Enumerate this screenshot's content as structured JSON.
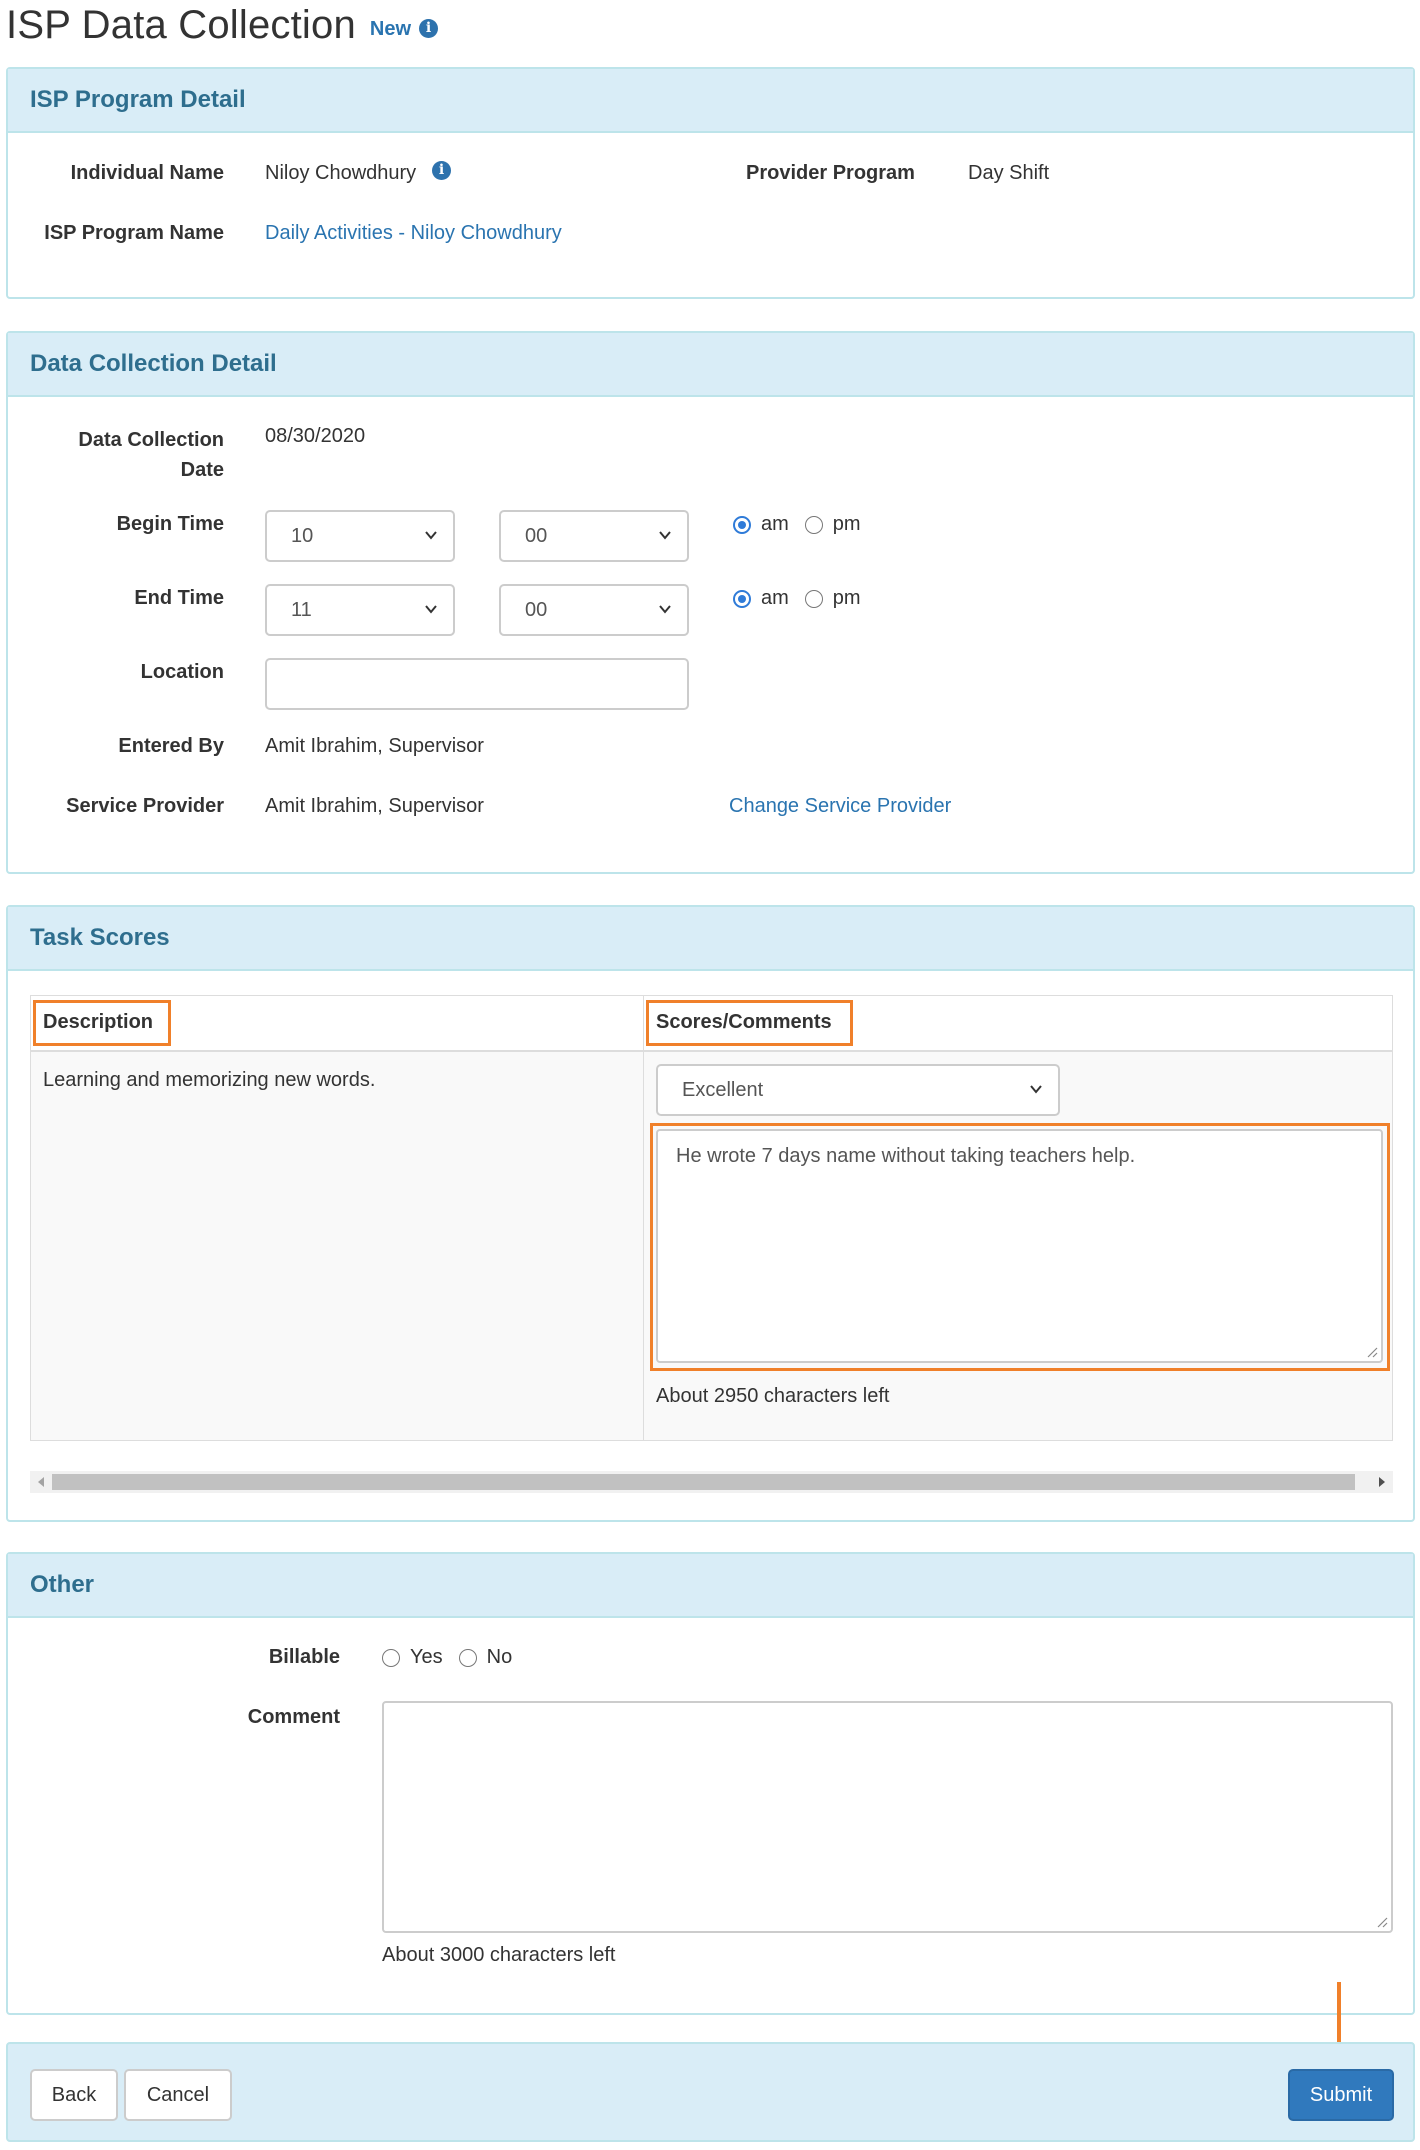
{
  "header": {
    "title": "ISP Data Collection",
    "badge": "New",
    "info_icon": "info-circle-icon"
  },
  "program_detail": {
    "heading": "ISP Program Detail",
    "individual_name_label": "Individual Name",
    "individual_name": "Niloy Chowdhury",
    "provider_program_label": "Provider Program",
    "provider_program": "Day Shift",
    "isp_program_name_label": "ISP Program Name",
    "isp_program_name": "Daily Activities - Niloy Chowdhury"
  },
  "collection_detail": {
    "heading": "Data Collection Detail",
    "date_label_line1": "Data Collection",
    "date_label_line2": "Date",
    "date": "08/30/2020",
    "begin_time_label": "Begin Time",
    "begin_hour": "10",
    "begin_minute": "00",
    "begin_period": "am",
    "end_time_label": "End Time",
    "end_hour": "11",
    "end_minute": "00",
    "end_period": "am",
    "am_label": "am",
    "pm_label": "pm",
    "location_label": "Location",
    "location_value": "",
    "entered_by_label": "Entered By",
    "entered_by": "Amit Ibrahim, Supervisor",
    "service_provider_label": "Service Provider",
    "service_provider": "Amit Ibrahim, Supervisor",
    "change_provider_link": "Change Service Provider"
  },
  "task_scores": {
    "heading": "Task Scores",
    "columns": [
      "Description",
      "Scores/Comments"
    ],
    "rows": [
      {
        "description": "Learning and memorizing new words.",
        "score": "Excellent",
        "comment": "He wrote 7 days name without taking teachers help.",
        "chars_left": "About 2950 characters left"
      }
    ]
  },
  "other": {
    "heading": "Other",
    "billable_label": "Billable",
    "yes_label": "Yes",
    "no_label": "No",
    "comment_label": "Comment",
    "comment_value": "",
    "chars_left": "About 3000 characters left"
  },
  "footer": {
    "back_label": "Back",
    "cancel_label": "Cancel",
    "submit_label": "Submit"
  },
  "colors": {
    "panel_heading_bg": "#d9edf7",
    "panel_heading_text": "#2e6e8e",
    "link": "#2a74b0",
    "primary_button": "#3079bd",
    "annotation": "#f0802a"
  }
}
